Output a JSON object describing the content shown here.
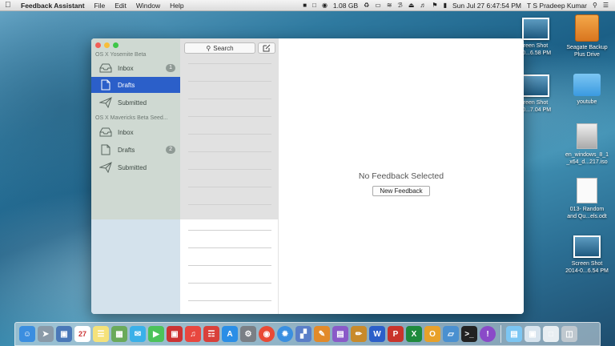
{
  "menubar": {
    "app_name": "Feedback Assistant",
    "menus": [
      "File",
      "Edit",
      "Window",
      "Help"
    ],
    "memory": "1.08 GB",
    "datetime": "Sun Jul 27  6:47:54 PM",
    "user": "T S Pradeep Kumar"
  },
  "sidebar": {
    "sections": [
      {
        "header": "OS X Yosemite Beta",
        "items": [
          {
            "label": "Inbox",
            "icon": "inbox-tray-icon",
            "badge": "1"
          },
          {
            "label": "Drafts",
            "icon": "document-icon",
            "selected": true
          },
          {
            "label": "Submitted",
            "icon": "paper-plane-icon"
          }
        ]
      },
      {
        "header": "OS X Mavericks Beta Seed...",
        "items": [
          {
            "label": "Inbox",
            "icon": "inbox-tray-icon"
          },
          {
            "label": "Drafts",
            "icon": "document-icon",
            "badge": "2"
          },
          {
            "label": "Submitted",
            "icon": "paper-plane-icon"
          }
        ]
      }
    ]
  },
  "list": {
    "search_label": "Search"
  },
  "detail": {
    "empty_message": "No Feedback Selected",
    "new_button": "New Feedback"
  },
  "desktop": {
    "items": [
      {
        "label_line1": "reen Shot",
        "label_line2": "-0...6.58 PM",
        "icon": "screenshot-thumbnail-icon"
      },
      {
        "label_line1": "Seagate Backup",
        "label_line2": "Plus Drive",
        "icon": "external-drive-icon"
      },
      {
        "label_line1": "reen Shot",
        "label_line2": "-0...7.04 PM",
        "icon": "screenshot-thumbnail-icon"
      },
      {
        "label_line1": "youtube",
        "label_line2": "",
        "icon": "folder-icon"
      },
      {
        "label_line1": "en_windows_8_1",
        "label_line2": "_x64_d...217.iso",
        "icon": "disk-image-icon"
      },
      {
        "label_line1": "013- Random",
        "label_line2": "and Qu...els.odt",
        "icon": "document-icon"
      },
      {
        "label_line1": "Screen Shot",
        "label_line2": "2014-0...6.54 PM",
        "icon": "screenshot-thumbnail-icon"
      }
    ]
  },
  "dock": {
    "calendar_day": "27",
    "colors": {
      "finder": "#3b8ee0",
      "chrome": "#e94a35",
      "word": "#2b5fc9",
      "excel": "#1e8a3c"
    }
  }
}
